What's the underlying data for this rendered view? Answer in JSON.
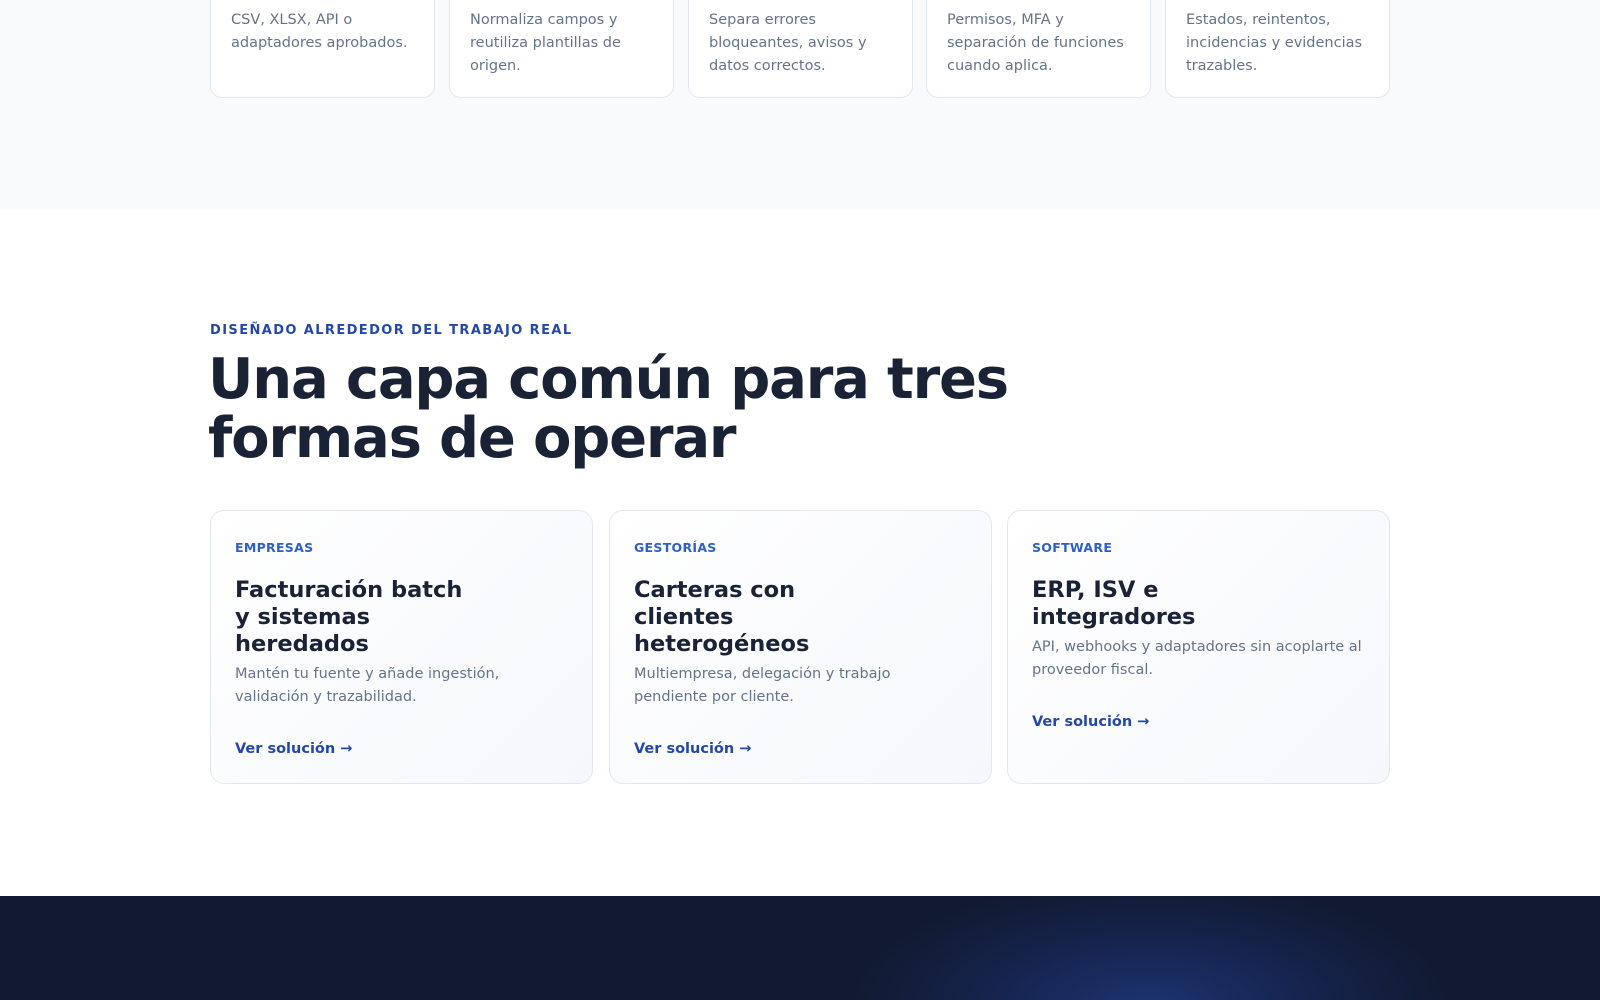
{
  "process_steps": [
    {
      "description": "CSV, XLSX, API o adaptadores aprobados."
    },
    {
      "description": "Normaliza campos y reutiliza plantillas de origen."
    },
    {
      "description": "Separa errores bloqueantes, avisos y datos correctos."
    },
    {
      "description": "Permisos, MFA y separación de funciones cuando aplica."
    },
    {
      "description": "Estados, reintentos, incidencias y evidencias trazables."
    }
  ],
  "solutions_section": {
    "eyebrow": "DISEÑADO ALREDEDOR DEL TRABAJO REAL",
    "title_line1": "Una capa común para tres",
    "title_line2": "formas de operar",
    "cards": [
      {
        "tag": "EMPRESAS",
        "title": "Facturación batch y sistemas heredados",
        "description": "Mantén tu fuente y añade ingestión, validación y trazabilidad.",
        "link": "Ver solución →"
      },
      {
        "tag": "GESTORÍAS",
        "title": "Carteras con clientes heterogéneos",
        "description": "Multiempresa, delegación y trabajo pendiente por cliente.",
        "link": "Ver solución →"
      },
      {
        "tag": "SOFTWARE",
        "title": "ERP, ISV e integradores",
        "description": "API, webhooks y adaptadores sin acoplarte al proveedor fiscal.",
        "link": "Ver solución →"
      }
    ]
  },
  "colors": {
    "accent": "#2348a8",
    "heading": "#1a2236",
    "muted_text": "#64748b",
    "band_light": "#f8fafc",
    "band_dark": "#111a30"
  }
}
